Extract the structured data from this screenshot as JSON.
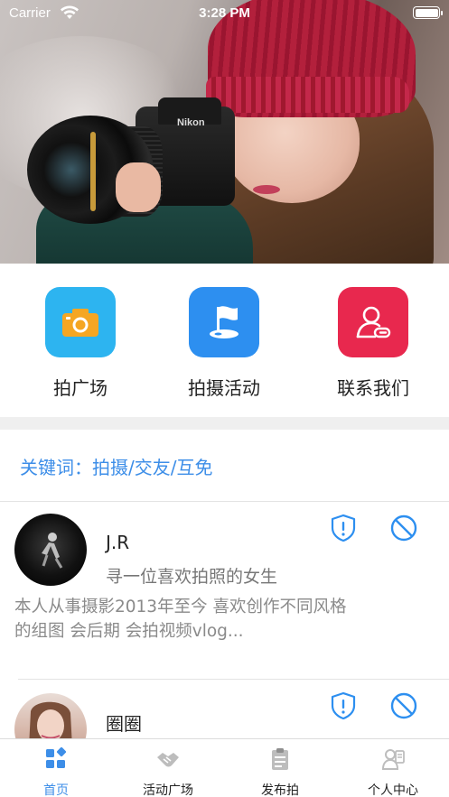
{
  "status_bar": {
    "carrier": "Carrier",
    "time": "3:28 PM"
  },
  "quick_menu": [
    {
      "label": "拍广场",
      "icon": "camera-icon",
      "color": "#2db4f0"
    },
    {
      "label": "拍摄活动",
      "icon": "flag-location-icon",
      "color": "#2d8ff0"
    },
    {
      "label": "联系我们",
      "icon": "contact-person-icon",
      "color": "#e8284e"
    }
  ],
  "keywords": "关键词：拍摄/交友/互免",
  "posts": [
    {
      "name": "J.R",
      "subtitle": "寻一位喜欢拍照的女生",
      "description": "本人从事摄影2013年至今 喜欢创作不同风格的组图 会后期 会拍视频vlog..."
    },
    {
      "name": "圈圈",
      "subtitle": "",
      "description": ""
    }
  ],
  "tabs": [
    {
      "label": "首页",
      "icon": "home-grid-icon",
      "active": true
    },
    {
      "label": "活动广场",
      "icon": "handshake-icon",
      "active": false
    },
    {
      "label": "发布拍",
      "icon": "clipboard-icon",
      "active": false
    },
    {
      "label": "个人中心",
      "icon": "user-card-icon",
      "active": false
    }
  ],
  "colors": {
    "accent": "#3d8ee8",
    "report_icon": "#2d8ff0"
  }
}
